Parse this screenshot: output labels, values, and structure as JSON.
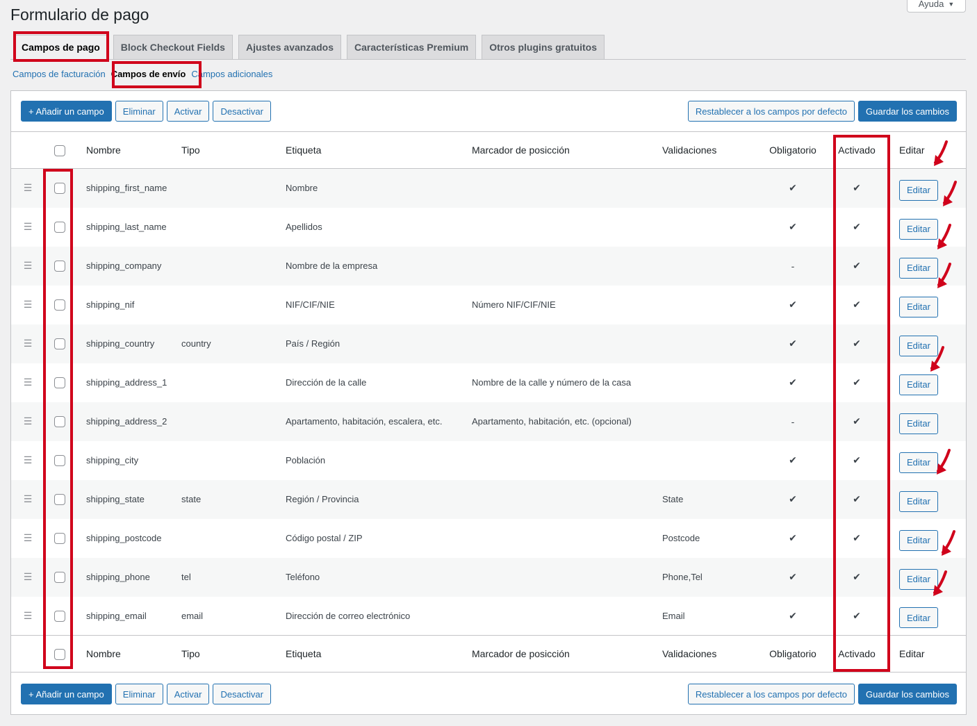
{
  "page": {
    "title": "Formulario de pago",
    "help_label": "Ayuda"
  },
  "tabs": [
    {
      "label": "Campos de pago",
      "active": true
    },
    {
      "label": "Block Checkout Fields",
      "active": false
    },
    {
      "label": "Ajustes avanzados",
      "active": false
    },
    {
      "label": "Características Premium",
      "active": false
    },
    {
      "label": "Otros plugins gratuitos",
      "active": false
    }
  ],
  "subnav": {
    "billing": "Campos de facturación",
    "shipping": "Campos de envío",
    "additional": "Campos adicionales"
  },
  "toolbar": {
    "add": "+ Añadir un campo",
    "delete": "Eliminar",
    "activate": "Activar",
    "deactivate": "Desactivar",
    "reset": "Restablecer a los campos por defecto",
    "save": "Guardar los cambios"
  },
  "columns": {
    "name": "Nombre",
    "type": "Tipo",
    "label": "Etiqueta",
    "placeholder": "Marcador de posicción",
    "validations": "Validaciones",
    "required": "Obligatorio",
    "enabled": "Activado",
    "edit": "Editar"
  },
  "rows": [
    {
      "name": "shipping_first_name",
      "type": "",
      "label": "Nombre",
      "placeholder": "",
      "validation": "",
      "required": "✔",
      "enabled": "✔",
      "edit": "Editar"
    },
    {
      "name": "shipping_last_name",
      "type": "",
      "label": "Apellidos",
      "placeholder": "",
      "validation": "",
      "required": "✔",
      "enabled": "✔",
      "edit": "Editar"
    },
    {
      "name": "shipping_company",
      "type": "",
      "label": "Nombre de la empresa",
      "placeholder": "",
      "validation": "",
      "required": "-",
      "enabled": "✔",
      "edit": "Editar"
    },
    {
      "name": "shipping_nif",
      "type": "",
      "label": "NIF/CIF/NIE",
      "placeholder": "Número NIF/CIF/NIE",
      "validation": "",
      "required": "✔",
      "enabled": "✔",
      "edit": "Editar"
    },
    {
      "name": "shipping_country",
      "type": "country",
      "label": "País / Región",
      "placeholder": "",
      "validation": "",
      "required": "✔",
      "enabled": "✔",
      "edit": "Editar"
    },
    {
      "name": "shipping_address_1",
      "type": "",
      "label": "Dirección de la calle",
      "placeholder": "Nombre de la calle y número de la casa",
      "validation": "",
      "required": "✔",
      "enabled": "✔",
      "edit": "Editar"
    },
    {
      "name": "shipping_address_2",
      "type": "",
      "label": "Apartamento, habitación, escalera, etc.",
      "placeholder": "Apartamento, habitación, etc. (opcional)",
      "validation": "",
      "required": "-",
      "enabled": "✔",
      "edit": "Editar"
    },
    {
      "name": "shipping_city",
      "type": "",
      "label": "Población",
      "placeholder": "",
      "validation": "",
      "required": "✔",
      "enabled": "✔",
      "edit": "Editar"
    },
    {
      "name": "shipping_state",
      "type": "state",
      "label": "Región / Provincia",
      "placeholder": "",
      "validation": "State",
      "required": "✔",
      "enabled": "✔",
      "edit": "Editar"
    },
    {
      "name": "shipping_postcode",
      "type": "",
      "label": "Código postal / ZIP",
      "placeholder": "",
      "validation": "Postcode",
      "required": "✔",
      "enabled": "✔",
      "edit": "Editar"
    },
    {
      "name": "shipping_phone",
      "type": "tel",
      "label": "Teléfono",
      "placeholder": "",
      "validation": "Phone,Tel",
      "required": "✔",
      "enabled": "✔",
      "edit": "Editar"
    },
    {
      "name": "shipping_email",
      "type": "email",
      "label": "Dirección de correo electrónico",
      "placeholder": "",
      "validation": "Email",
      "required": "✔",
      "enabled": "✔",
      "edit": "Editar"
    }
  ],
  "icons": {
    "drag": "drag-handle-icon",
    "check": "checkmark-icon",
    "annotation": "red-arrow-icon"
  },
  "colors": {
    "accent": "#2271b1",
    "highlight": "#d0021b"
  }
}
